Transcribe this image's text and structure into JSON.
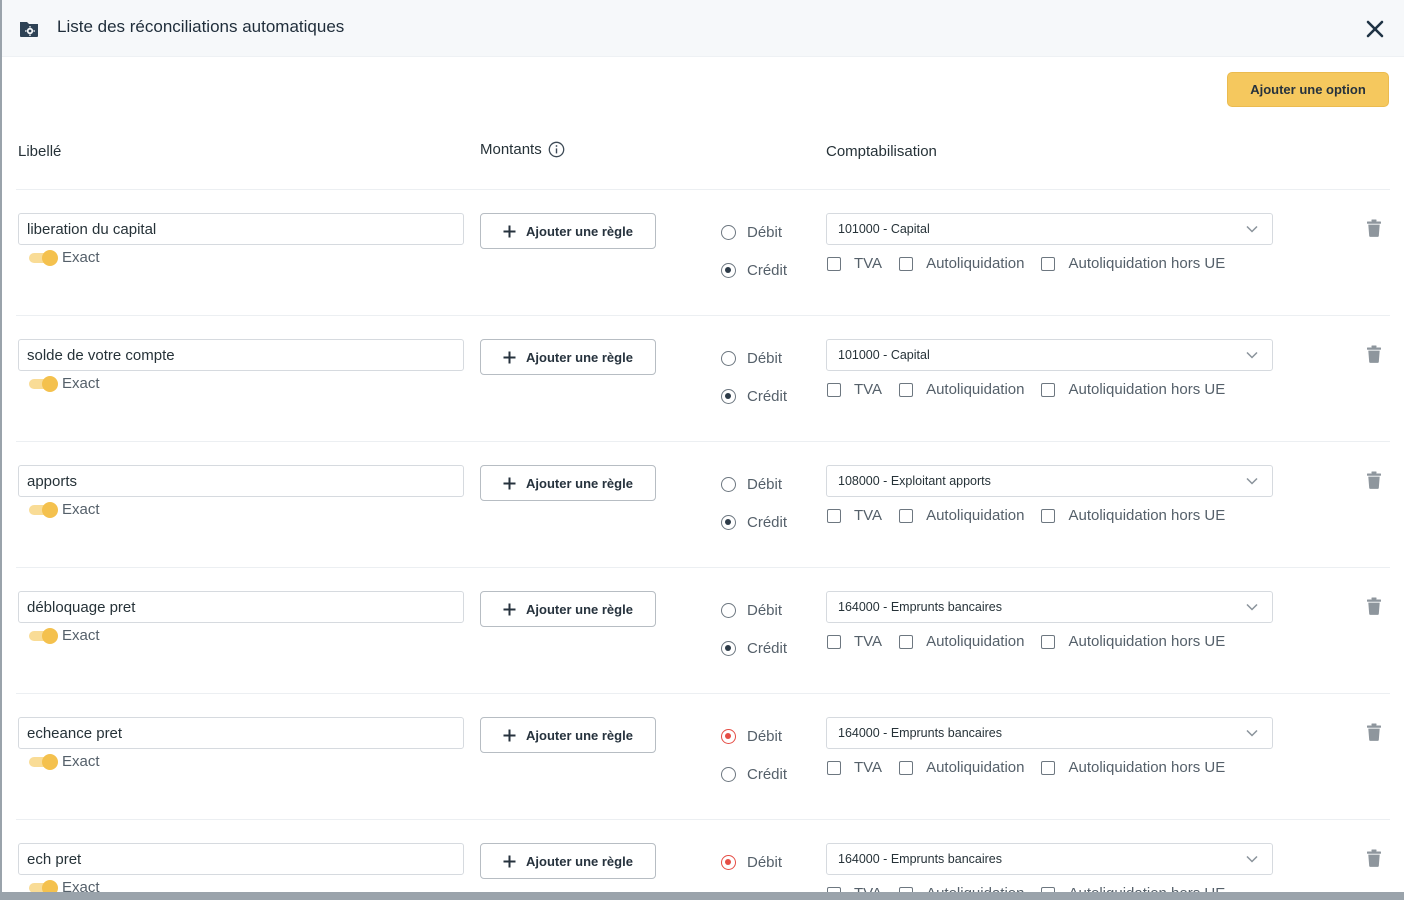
{
  "modal": {
    "title": "Liste des réconciliations automatiques",
    "add_option_label": "Ajouter une option"
  },
  "columns": {
    "libelle": "Libellé",
    "montants": "Montants",
    "comptabilisation": "Comptabilisation"
  },
  "labels": {
    "exact": "Exact",
    "add_rule": "Ajouter une règle",
    "debit": "Débit",
    "credit": "Crédit",
    "tva": "TVA",
    "autoliquidation": "Autoliquidation",
    "autoliquidation_hors_ue": "Autoliquidation hors UE"
  },
  "rows": [
    {
      "libelle": "liberation du capital",
      "account": "101000 - Capital",
      "direction": "credit",
      "exact": true
    },
    {
      "libelle": "solde de votre compte",
      "account": "101000 - Capital",
      "direction": "credit",
      "exact": true
    },
    {
      "libelle": "apports",
      "account": "108000 - Exploitant apports",
      "direction": "credit",
      "exact": true
    },
    {
      "libelle": "débloquage pret",
      "account": "164000 - Emprunts bancaires",
      "direction": "credit",
      "exact": true
    },
    {
      "libelle": "echeance pret",
      "account": "164000 - Emprunts bancaires",
      "direction": "debit",
      "exact": true
    },
    {
      "libelle": "ech pret",
      "account": "164000 - Emprunts bancaires",
      "direction": "debit",
      "exact": true
    }
  ],
  "colors": {
    "accent_yellow": "#f5c85e",
    "debit_red": "#e54d45",
    "text_dark": "#263238"
  }
}
